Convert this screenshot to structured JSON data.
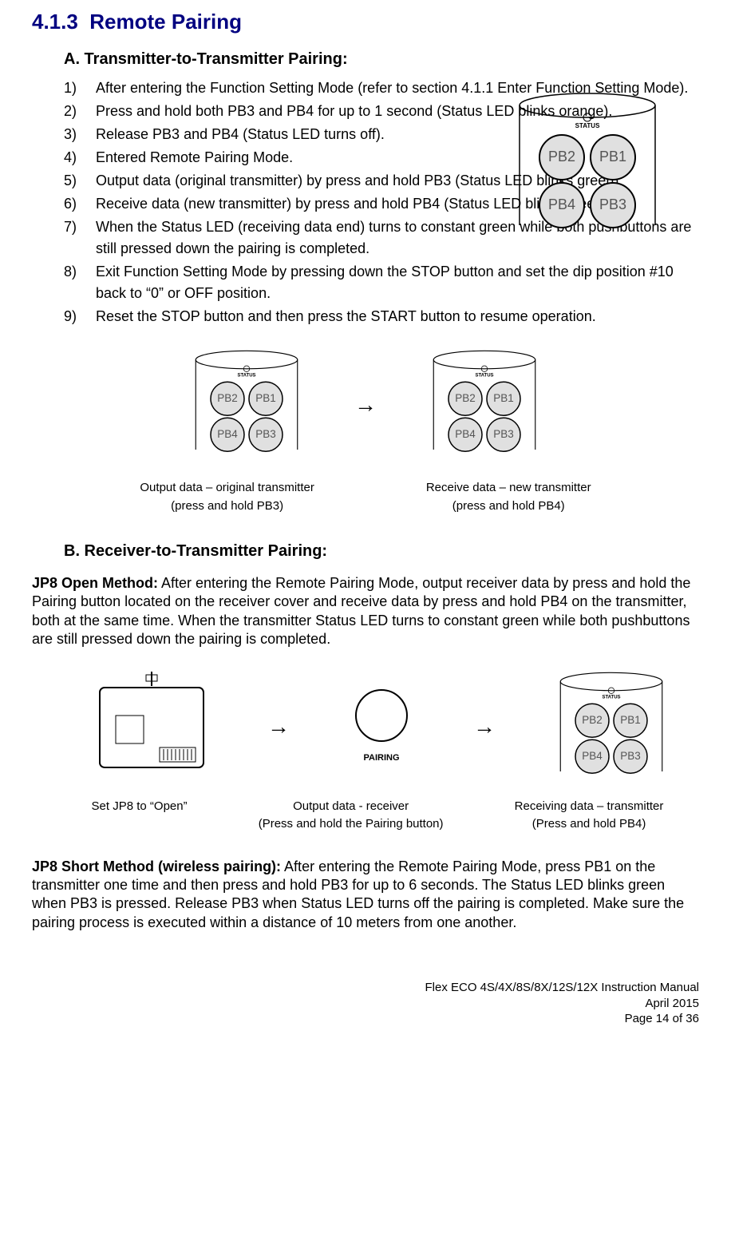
{
  "section": {
    "number": "4.1.3",
    "title": "Remote Pairing"
  },
  "sectionA": {
    "heading": "A. Transmitter-to-Transmitter Pairing:",
    "steps": [
      "After entering the Function Setting Mode (refer to section 4.1.1 Enter Function Setting Mode).",
      "Press and hold both PB3 and PB4 for up to 1 second (Status LED blinks orange).",
      "Release PB3 and PB4 (Status LED turns off).",
      "Entered Remote Pairing Mode.",
      "Output data (original transmitter) by press and hold PB3 (Status LED blinks green).",
      "Receive data (new transmitter) by press and hold PB4 (Status LED blinks green).",
      "When the Status LED (receiving data end) turns to constant green while both pushbuttons are still pressed down the pairing is completed.",
      "Exit Function Setting Mode by pressing down the STOP button and set the dip position #10 back to “0” or OFF position.",
      "Reset the STOP button and then press the START button to resume operation."
    ],
    "captionLeft1": "Output data – original transmitter",
    "captionLeft2": "(press and hold PB3)",
    "captionRight1": "Receive data – new transmitter",
    "captionRight2": "(press and hold PB4)"
  },
  "sectionB": {
    "heading": "B. Receiver-to-Transmitter Pairing:",
    "jp8OpenLabel": "JP8 Open Method:",
    "jp8OpenText": "  After entering the Remote Pairing Mode, output receiver data by press and hold the Pairing button located on the receiver cover and receive data by press and hold PB4 on the transmitter, both at the same time.  When the transmitter Status LED turns to constant green while both pushbuttons are still pressed down the pairing is completed.",
    "cap1": "Set JP8 to “Open”",
    "cap2a": "Output data - receiver",
    "cap2b": "(Press and hold the Pairing button)",
    "cap3a": "Receiving data – transmitter",
    "cap3b": "(Press and hold PB4)",
    "jp8ShortLabel": "JP8 Short Method (wireless pairing):",
    "jp8ShortText": "  After entering the Remote Pairing Mode, press PB1 on the transmitter one time and then press and hold PB3 for up to 6 seconds.  The Status LED blinks green when PB3 is pressed.  Release PB3 when Status LED turns off the pairing is completed.  Make sure the pairing process is executed within a distance of 10 meters from one another."
  },
  "buttons": {
    "pb1": "PB1",
    "pb2": "PB2",
    "pb3": "PB3",
    "pb4": "PB4",
    "status": "STATUS",
    "pairing": "PAIRING"
  },
  "arrow": "→",
  "footer": {
    "line1": "Flex ECO 4S/4X/8S/8X/12S/12X Instruction Manual",
    "line2": "April 2015",
    "line3": "Page 14 of 36"
  }
}
